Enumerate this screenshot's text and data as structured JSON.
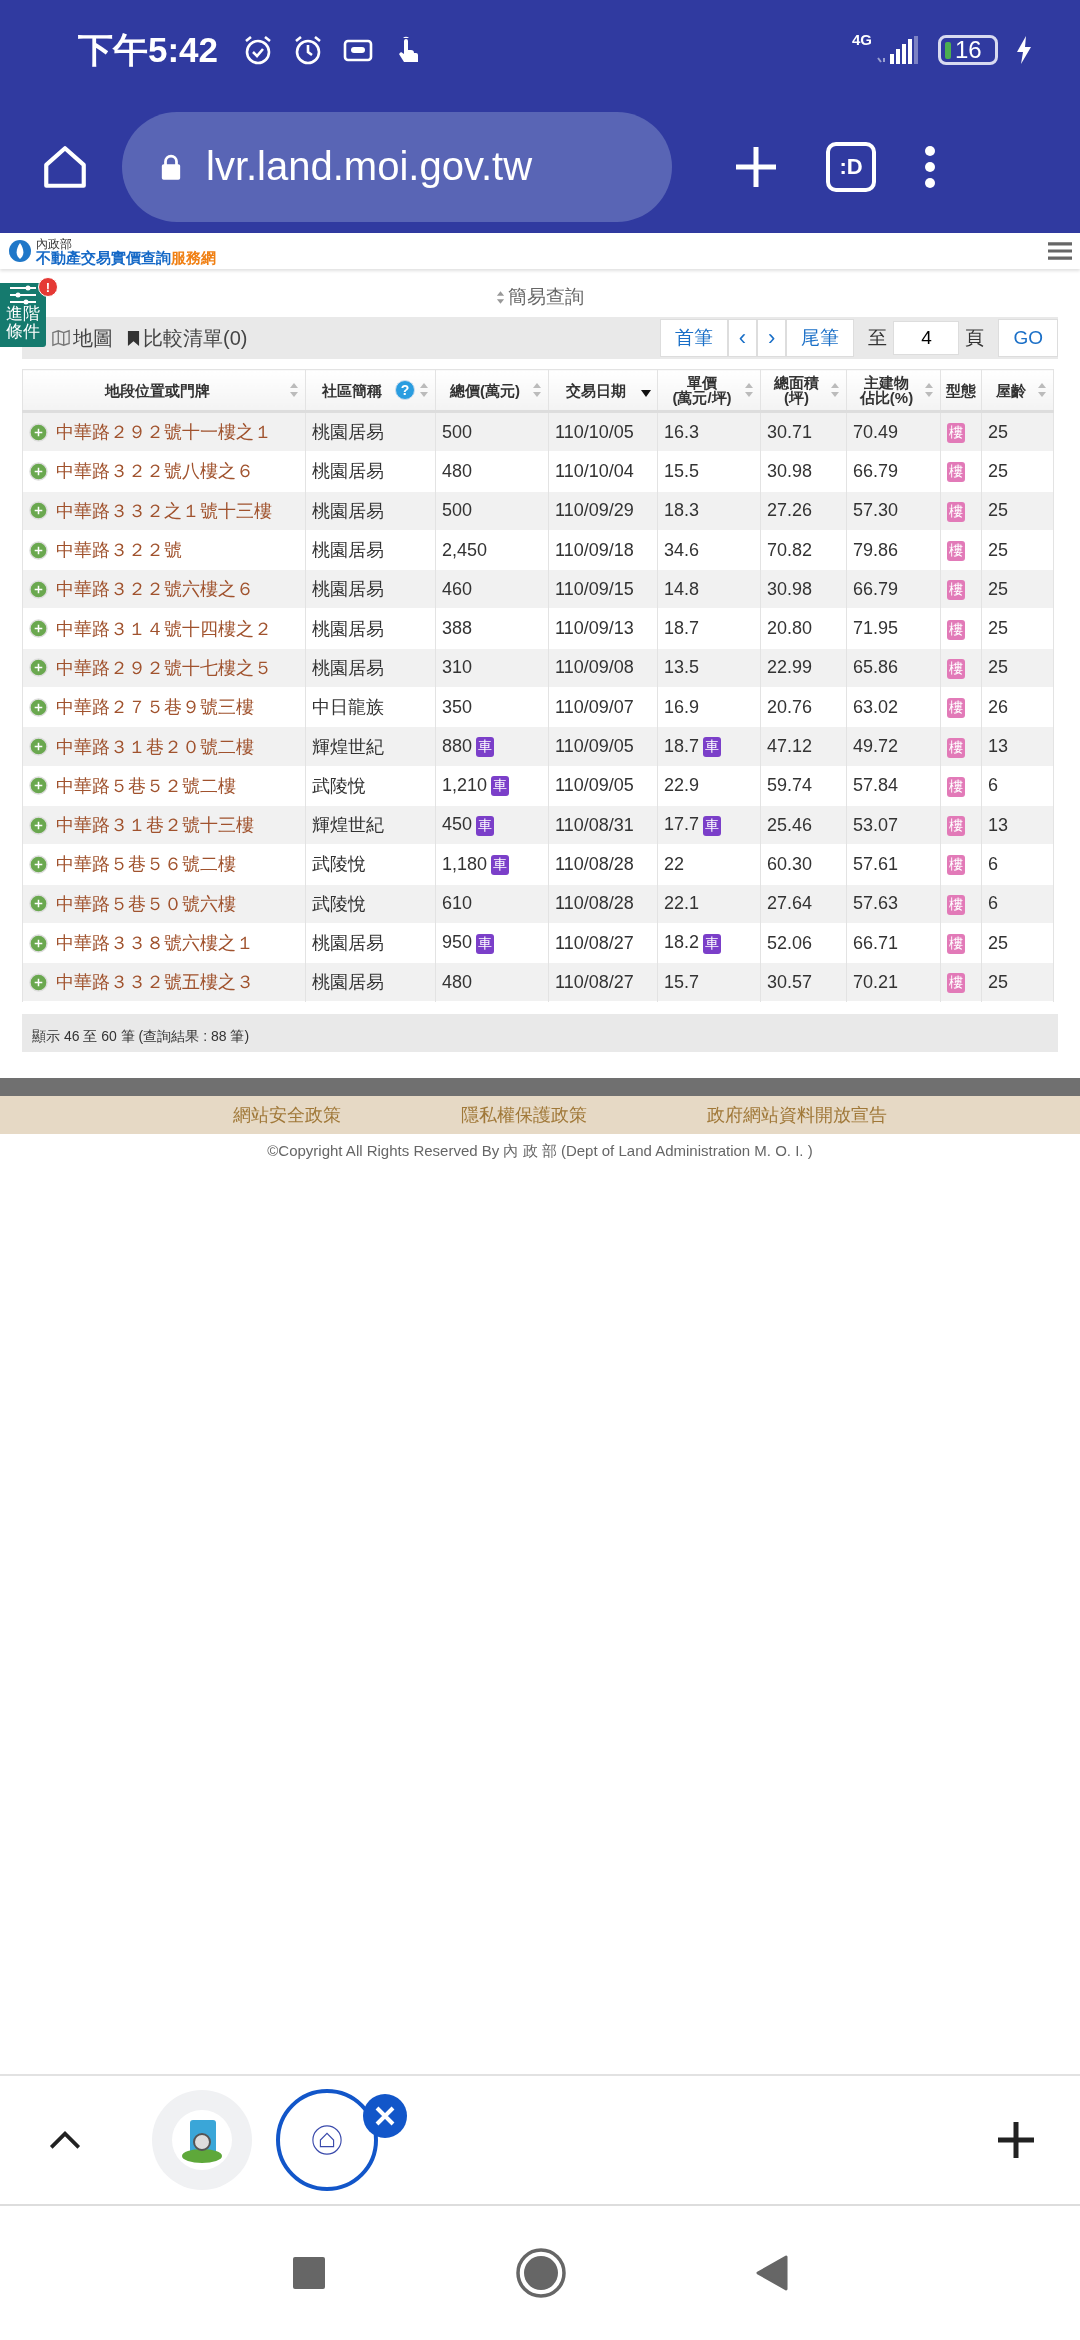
{
  "status_bar": {
    "time": "下午5:42",
    "network": "4G",
    "battery": "16"
  },
  "browser": {
    "url": "lvr.land.moi.gov.tw",
    "tab_badge": ":D"
  },
  "site": {
    "ministry": "內政部",
    "title": "不動產交易實價查詢",
    "title_suffix": "服務網"
  },
  "advanced_button": {
    "label": [
      "進階",
      "條件"
    ],
    "alert": "!"
  },
  "query_toggle": "簡易查詢",
  "toolbar": {
    "map": "地圖",
    "compare": "比較清單(0)",
    "first": "首筆",
    "prev": "‹",
    "next": "›",
    "last": "尾筆",
    "to": "至",
    "page": "4",
    "page_suffix": "頁",
    "go": "GO"
  },
  "table": {
    "columns": [
      {
        "label": [
          "地段位置或門牌"
        ],
        "sortable": true,
        "sorted": false
      },
      {
        "label": [
          "社區簡稱"
        ],
        "sortable": true,
        "sorted": false,
        "help": "?"
      },
      {
        "label": [
          "總價(萬元)"
        ],
        "sortable": true,
        "sorted": false
      },
      {
        "label": [
          "交易日期"
        ],
        "sortable": true,
        "sorted": true
      },
      {
        "label": [
          "單價",
          "(萬元/坪)"
        ],
        "sortable": true,
        "sorted": false
      },
      {
        "label": [
          "總面積",
          "(坪)"
        ],
        "sortable": true,
        "sorted": false
      },
      {
        "label": [
          "主建物",
          "佔比(%)"
        ],
        "sortable": true,
        "sorted": false
      },
      {
        "label": [
          "型態"
        ],
        "sortable": false
      },
      {
        "label": [
          "屋齡"
        ],
        "sortable": true,
        "sorted": false
      }
    ],
    "rows": [
      {
        "address": "中華路２９２號十一樓之１",
        "community": "桃園居易",
        "total_price": "500",
        "date": "110/10/05",
        "unit_price": "16.3",
        "area": "30.71",
        "main_ratio": "70.49",
        "type": "樓",
        "age": "25"
      },
      {
        "address": "中華路３２２號八樓之６",
        "community": "桃園居易",
        "total_price": "480",
        "date": "110/10/04",
        "unit_price": "15.5",
        "area": "30.98",
        "main_ratio": "66.79",
        "type": "樓",
        "age": "25"
      },
      {
        "address": "中華路３３２之１號十三樓",
        "community": "桃園居易",
        "total_price": "500",
        "date": "110/09/29",
        "unit_price": "18.3",
        "area": "27.26",
        "main_ratio": "57.30",
        "type": "樓",
        "age": "25"
      },
      {
        "address": "中華路３２２號",
        "community": "桃園居易",
        "total_price": "2,450",
        "date": "110/09/18",
        "unit_price": "34.6",
        "area": "70.82",
        "main_ratio": "79.86",
        "type": "樓",
        "age": "25"
      },
      {
        "address": "中華路３２２號六樓之６",
        "community": "桃園居易",
        "total_price": "460",
        "date": "110/09/15",
        "unit_price": "14.8",
        "area": "30.98",
        "main_ratio": "66.79",
        "type": "樓",
        "age": "25"
      },
      {
        "address": "中華路３１４號十四樓之２",
        "community": "桃園居易",
        "total_price": "388",
        "date": "110/09/13",
        "unit_price": "18.7",
        "area": "20.80",
        "main_ratio": "71.95",
        "type": "樓",
        "age": "25"
      },
      {
        "address": "中華路２９２號十七樓之５",
        "community": "桃園居易",
        "total_price": "310",
        "date": "110/09/08",
        "unit_price": "13.5",
        "area": "22.99",
        "main_ratio": "65.86",
        "type": "樓",
        "age": "25"
      },
      {
        "address": "中華路２７５巷９號三樓",
        "community": "中日龍族",
        "total_price": "350",
        "date": "110/09/07",
        "unit_price": "16.9",
        "area": "20.76",
        "main_ratio": "63.02",
        "type": "樓",
        "age": "26"
      },
      {
        "address": "中華路３１巷２０號二樓",
        "community": "輝煌世紀",
        "total_price": "880",
        "total_price_tag": "車",
        "date": "110/09/05",
        "unit_price": "18.7",
        "unit_price_tag": "車",
        "area": "47.12",
        "main_ratio": "49.72",
        "type": "樓",
        "age": "13"
      },
      {
        "address": "中華路５巷５２號二樓",
        "community": "武陵悅",
        "total_price": "1,210",
        "total_price_tag": "車",
        "date": "110/09/05",
        "unit_price": "22.9",
        "area": "59.74",
        "main_ratio": "57.84",
        "type": "樓",
        "age": "6"
      },
      {
        "address": "中華路３１巷２號十三樓",
        "community": "輝煌世紀",
        "total_price": "450",
        "total_price_tag": "車",
        "date": "110/08/31",
        "unit_price": "17.7",
        "unit_price_tag": "車",
        "area": "25.46",
        "main_ratio": "53.07",
        "type": "樓",
        "age": "13"
      },
      {
        "address": "中華路５巷５６號二樓",
        "community": "武陵悅",
        "total_price": "1,180",
        "total_price_tag": "車",
        "date": "110/08/28",
        "unit_price": "22",
        "area": "60.30",
        "main_ratio": "57.61",
        "type": "樓",
        "age": "6"
      },
      {
        "address": "中華路５巷５０號六樓",
        "community": "武陵悅",
        "total_price": "610",
        "date": "110/08/28",
        "unit_price": "22.1",
        "area": "27.64",
        "main_ratio": "57.63",
        "type": "樓",
        "age": "6"
      },
      {
        "address": "中華路３３８號六樓之１",
        "community": "桃園居易",
        "total_price": "950",
        "total_price_tag": "車",
        "date": "110/08/27",
        "unit_price": "18.2",
        "unit_price_tag": "車",
        "area": "52.06",
        "main_ratio": "66.71",
        "type": "樓",
        "age": "25"
      },
      {
        "address": "中華路３３２號五樓之３",
        "community": "桃園居易",
        "total_price": "480",
        "date": "110/08/27",
        "unit_price": "15.7",
        "area": "30.57",
        "main_ratio": "70.21",
        "type": "樓",
        "age": "25"
      }
    ],
    "summary": "顯示 46 至 60 筆 (查詢結果 : 88 筆)"
  },
  "footer": {
    "links": [
      "網站安全政策",
      "隱私權保護政策",
      "政府網站資料開放宣告"
    ],
    "copyright": "©Copyright All Rights Reserved By 內 政 部 (Dept of Land Administration M. O. I. )"
  }
}
